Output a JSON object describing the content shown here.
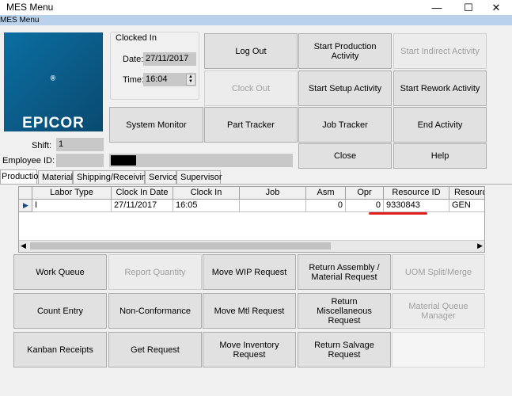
{
  "window": {
    "title": "MES Menu",
    "minimize": "—",
    "maximize": "☐",
    "close": "✕"
  },
  "menubar": {
    "label": "MES Menu"
  },
  "logo": {
    "text": "EPICOR",
    "mark": "®"
  },
  "clocked_in": {
    "title": "Clocked In",
    "date_label": "Date:",
    "date_value": "27/11/2017",
    "time_label": "Time:",
    "time_value": "16:04"
  },
  "top_buttons": {
    "log_out": "Log Out",
    "start_production": "Start Production Activity",
    "start_indirect": "Start Indirect Activity",
    "clock_out": "Clock Out",
    "start_setup": "Start Setup Activity",
    "start_rework": "Start Rework Activity",
    "system_monitor": "System Monitor",
    "part_tracker": "Part Tracker",
    "job_tracker": "Job Tracker",
    "end_activity": "End Activity",
    "close": "Close",
    "help": "Help"
  },
  "employee": {
    "shift_label": "Shift:",
    "shift_value": "1",
    "employee_id_label": "Employee ID:"
  },
  "tabs": [
    "Production",
    "Material",
    "Shipping/Receiving",
    "Service",
    "Supervisor"
  ],
  "grid": {
    "columns": [
      "Labor Type",
      "Clock In Date",
      "Clock In",
      "Job",
      "Asm",
      "Opr",
      "Resource ID",
      "Resource Grou"
    ],
    "rows": [
      [
        "I",
        "27/11/2017",
        "16:05",
        "",
        "0",
        "0",
        "9330843",
        "GEN"
      ]
    ]
  },
  "bottom_buttons": {
    "work_queue": "Work Queue",
    "report_quantity": "Report Quantity",
    "move_wip": "Move WIP Request",
    "return_assembly": "Return Assembly / Material Request",
    "uom_split": "UOM Split/Merge",
    "count_entry": "Count Entry",
    "non_conformance": "Non-Conformance",
    "move_mtl": "Move Mtl Request",
    "return_misc": "Return Miscellaneous Request",
    "material_queue": "Material Queue Manager",
    "kanban": "Kanban Receipts",
    "get_request": "Get Request",
    "move_inventory": "Move Inventory Request",
    "return_salvage": "Return Salvage Request"
  },
  "colors": {
    "titlebar": "#ffffff",
    "menubar": "#b9d1ea",
    "logo_bg": "#0b5a86",
    "highlight_underline": "#e02020",
    "button": "#e1e1e1"
  }
}
